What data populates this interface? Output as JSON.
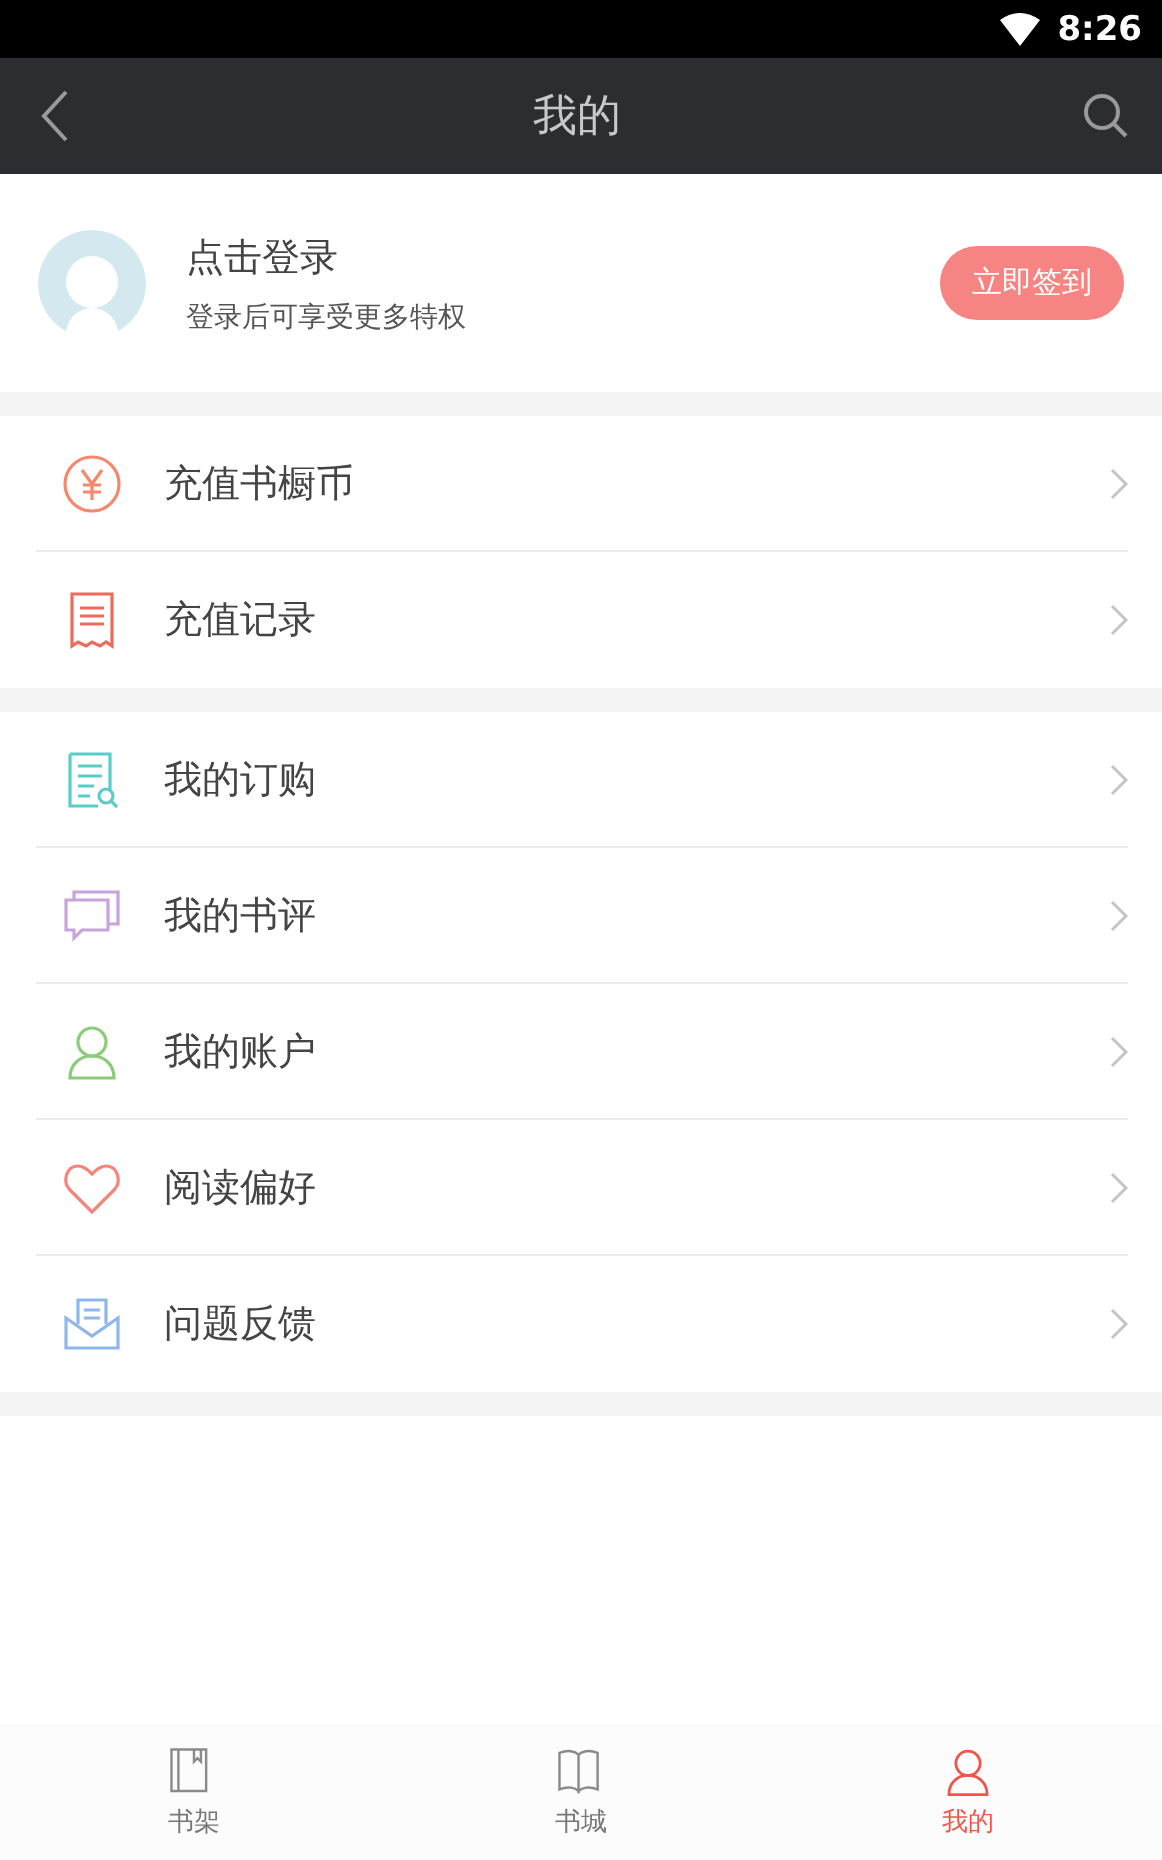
{
  "status_bar": {
    "time": "8:26"
  },
  "toolbar": {
    "title": "我的"
  },
  "profile": {
    "name": "点击登录",
    "subtitle": "登录后可享受更多特权",
    "button": "立即签到"
  },
  "menu_groups": [
    {
      "items": [
        {
          "label": "充值书橱币",
          "kind": "yen",
          "color": "#f6886c"
        },
        {
          "label": "充值记录",
          "kind": "receipt",
          "color": "#ee6a5a"
        }
      ]
    },
    {
      "items": [
        {
          "label": "我的订购",
          "kind": "order",
          "color": "#5bcdc9"
        },
        {
          "label": "我的书评",
          "kind": "comments",
          "color": "#c8a4dc"
        },
        {
          "label": "我的账户",
          "kind": "user",
          "color": "#8ccc78"
        },
        {
          "label": "阅读偏好",
          "kind": "heart",
          "color": "#f4857a"
        },
        {
          "label": "问题反馈",
          "kind": "mail",
          "color": "#8eb7ec"
        }
      ]
    }
  ],
  "bottom_nav": [
    {
      "label": "书架",
      "kind": "shelf",
      "selected": false
    },
    {
      "label": "书城",
      "kind": "book",
      "selected": false
    },
    {
      "label": "我的",
      "kind": "user",
      "selected": true
    }
  ]
}
